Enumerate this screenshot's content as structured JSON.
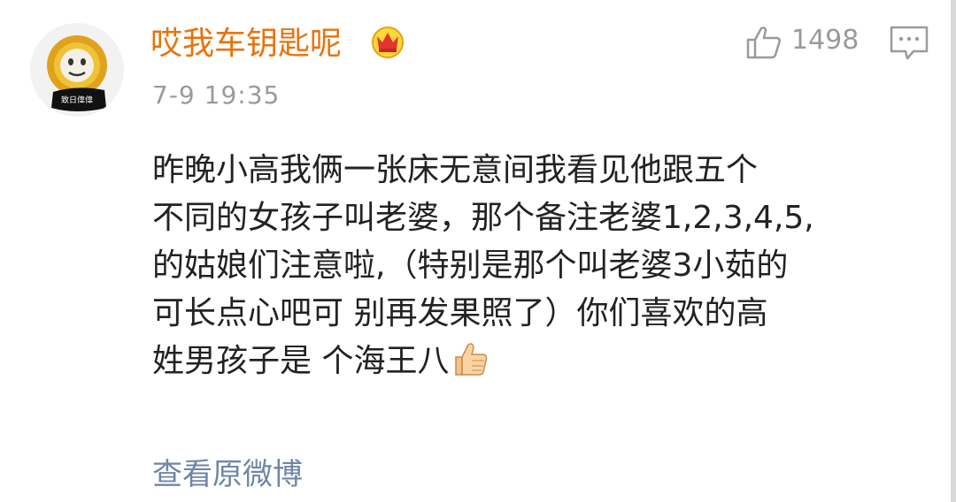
{
  "comment": {
    "avatar_caption": "致日偉偉",
    "username": "哎我车钥匙呢",
    "timestamp": "7-9 19:35",
    "like_count": "1498",
    "content_lines": [
      "昨晚小高我俩一张床无意间我看见他跟五个",
      "不同的女孩子叫老婆，那个备注老婆1,2,3,4,5,",
      "的姑娘们注意啦,（特别是那个叫老婆3小茹的",
      "可长点心吧可 别再发果照了）你们喜欢的高",
      "姓男孩子是 个海王八"
    ],
    "view_original_label": "查看原微博"
  },
  "icons": {
    "badge": "vip-crown-badge-icon",
    "like": "thumbs-up-outline-icon",
    "comment": "comment-bubble-icon",
    "emoji": "thumbs-up-emoji-icon"
  },
  "colors": {
    "username": "#e8730c",
    "meta": "#9a9a9a",
    "text": "#222222",
    "link": "#6f86a6"
  }
}
